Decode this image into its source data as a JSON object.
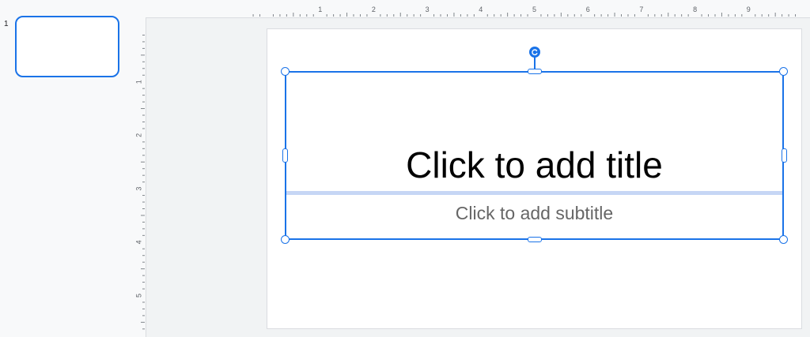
{
  "filmstrip": {
    "slides": [
      {
        "number": "1"
      }
    ]
  },
  "ruler": {
    "horizontal_labels": [
      "1",
      "2",
      "3",
      "4",
      "5",
      "6",
      "7",
      "8",
      "9"
    ],
    "vertical_labels": [
      "1",
      "2",
      "3",
      "4",
      "5"
    ]
  },
  "slide": {
    "title_placeholder": "Click to add title",
    "subtitle_placeholder": "Click to add subtitle"
  },
  "colors": {
    "selection": "#1a73e8",
    "background": "#f8f9fa",
    "subtitle_text": "#666666"
  },
  "icons": {
    "rotate": "rotate-handle-icon"
  }
}
